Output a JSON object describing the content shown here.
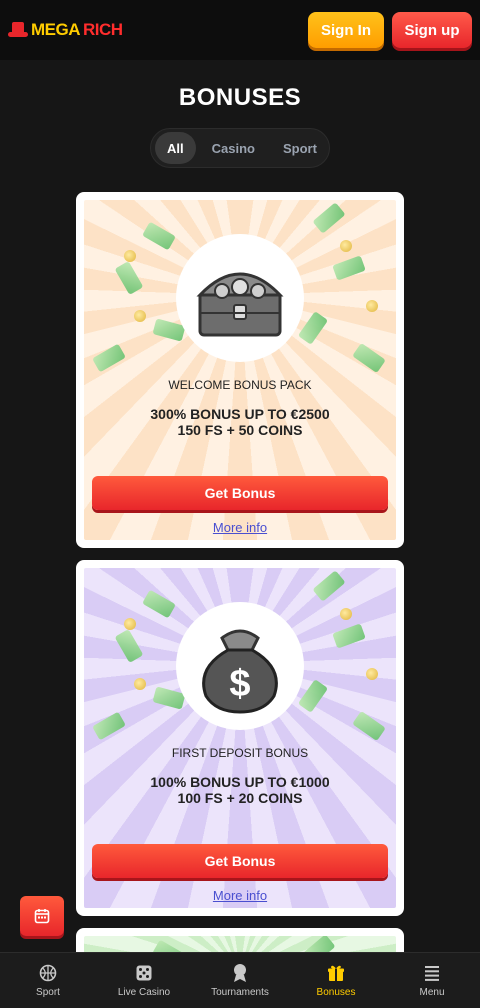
{
  "header": {
    "logo_part1": "MEGA",
    "logo_part2": "RICH",
    "signin_label": "Sign In",
    "signup_label": "Sign up"
  },
  "page_title": "BONUSES",
  "filters": [
    {
      "label": "All",
      "active": true
    },
    {
      "label": "Casino",
      "active": false
    },
    {
      "label": "Sport",
      "active": false
    }
  ],
  "bonuses": [
    {
      "title": "WELCOME BONUS PACK",
      "offer_line1": "300% BONUS UP TO €2500",
      "offer_line2": "150 FS + 50 COINS",
      "button": "Get Bonus",
      "more": "More info",
      "image_icon": "treasure-chest-icon"
    },
    {
      "title": "FIRST DEPOSIT BONUS",
      "offer_line1": "100% BONUS UP TO €1000",
      "offer_line2": "100 FS + 20 COINS",
      "button": "Get Bonus",
      "more": "More info",
      "image_icon": "money-bag-icon"
    }
  ],
  "bottom_nav": [
    {
      "label": "Sport",
      "icon": "basketball-icon",
      "active": false
    },
    {
      "label": "Live Casino",
      "icon": "dice-icon",
      "active": false
    },
    {
      "label": "Tournaments",
      "icon": "trophy-icon",
      "active": false
    },
    {
      "label": "Bonuses",
      "icon": "gift-icon",
      "active": true
    },
    {
      "label": "Menu",
      "icon": "hamburger-icon",
      "active": false
    }
  ],
  "colors": {
    "accent_yellow": "#ffcc00",
    "accent_red": "#e8262b",
    "background": "#161616"
  }
}
